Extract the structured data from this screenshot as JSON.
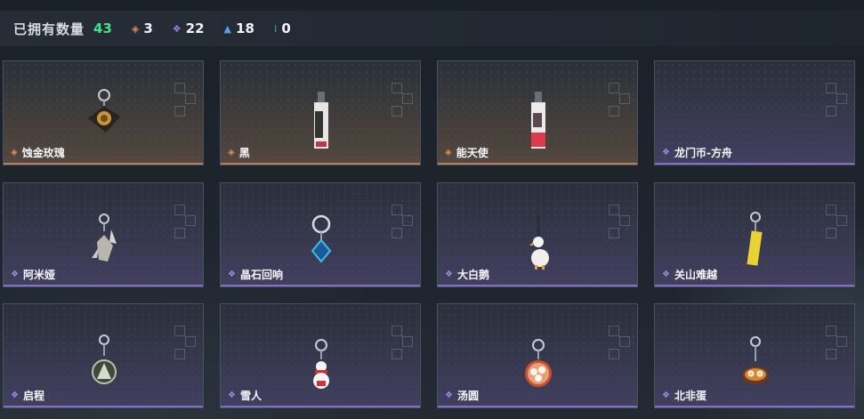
{
  "header": {
    "title": "已拥有数量",
    "total": "43",
    "stats": [
      {
        "icon": "orange-diamond-icon",
        "value": "3"
      },
      {
        "icon": "purple-diamond-icon",
        "value": "22"
      },
      {
        "icon": "blue-chevron-icon",
        "value": "18"
      },
      {
        "icon": "teal-dots-icon",
        "value": "0"
      }
    ]
  },
  "colors": {
    "accent_green": "#45e08e",
    "rarity_orange": "#d98b5a",
    "rarity_purple": "#9b7fe0",
    "rarity_blue": "#5a9ee0",
    "rarity_teal": "#3fd0b5"
  },
  "items": [
    {
      "name": "蚀金玫瑰",
      "rarity": "orange",
      "icon": "golden-rose-keychain-icon"
    },
    {
      "name": "黑",
      "rarity": "orange",
      "icon": "black-tag-keychain-icon"
    },
    {
      "name": "能天使",
      "rarity": "orange",
      "icon": "exusiai-tag-keychain-icon"
    },
    {
      "name": "龙门币-方舟",
      "rarity": "purple",
      "icon": "lmd-coin-keychain-icon"
    },
    {
      "name": "阿米娅",
      "rarity": "purple",
      "icon": "amiya-keychain-icon"
    },
    {
      "name": "晶石回响",
      "rarity": "purple",
      "icon": "crystal-keychain-icon"
    },
    {
      "name": "大白鹅",
      "rarity": "purple",
      "icon": "white-goose-keychain-icon"
    },
    {
      "name": "关山难越",
      "rarity": "purple",
      "icon": "gold-bar-keychain-icon"
    },
    {
      "name": "启程",
      "rarity": "purple",
      "icon": "departure-emblem-keychain-icon"
    },
    {
      "name": "雪人",
      "rarity": "purple",
      "icon": "snowman-keychain-icon"
    },
    {
      "name": "汤圆",
      "rarity": "purple",
      "icon": "tangyuan-bowl-keychain-icon"
    },
    {
      "name": "北非蛋",
      "rarity": "purple",
      "icon": "shakshuka-keychain-icon"
    }
  ]
}
